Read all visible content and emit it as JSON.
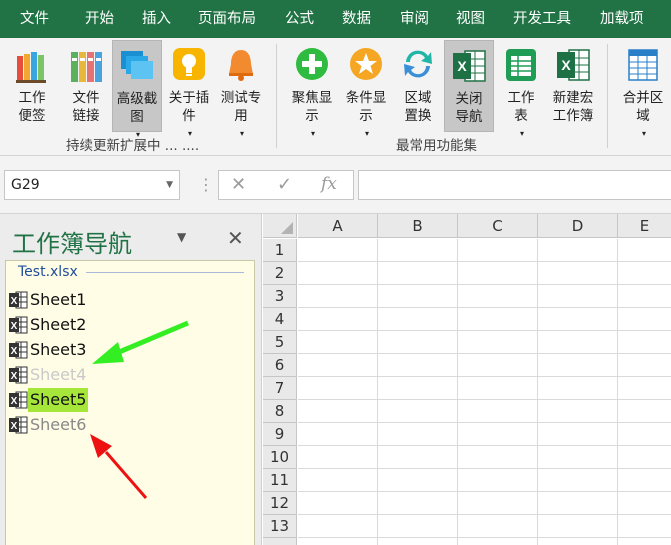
{
  "menu": {
    "items": [
      "文件",
      "开始",
      "插入",
      "页面布局",
      "公式",
      "数据",
      "审阅",
      "视图",
      "开发工具",
      "加载项"
    ]
  },
  "ribbon": {
    "buttons": [
      {
        "line1": "工作",
        "line2": "便签",
        "icon": "sticky-notes-icon"
      },
      {
        "line1": "文件",
        "line2": "链接",
        "icon": "file-link-icon"
      },
      {
        "line1": "高级截",
        "line2": "图",
        "icon": "screenshot-icon",
        "dropdown": true,
        "selected": true
      },
      {
        "line1": "关于插",
        "line2": "件",
        "icon": "lightbulb-icon",
        "dropdown": true
      },
      {
        "line1": "测试专",
        "line2": "用",
        "icon": "bell-icon",
        "dropdown": true
      },
      {
        "line1": "聚焦显",
        "line2": "示",
        "icon": "plus-circle-icon",
        "dropdown": true
      },
      {
        "line1": "条件显",
        "line2": "示",
        "icon": "star-circle-icon",
        "dropdown": true
      },
      {
        "line1": "区域",
        "line2": "置换",
        "icon": "swap-arrows-icon"
      },
      {
        "line1": "关闭",
        "line2": "导航",
        "icon": "excel-icon",
        "selected": true
      },
      {
        "line1": "工作",
        "line2": "表",
        "icon": "worksheet-icon",
        "dropdown": true
      },
      {
        "line1": "新建宏",
        "line2": "工作簿",
        "icon": "macro-workbook-icon"
      },
      {
        "line1": "合并区",
        "line2": "域",
        "icon": "merge-range-icon",
        "dropdown": true
      }
    ],
    "groups": {
      "group1": "持续更新扩展中 ... ....",
      "group2": "最常用功能集"
    },
    "dropdown_arrow": "▾"
  },
  "formula_bar": {
    "name_box": "G29",
    "cancel": "✕",
    "confirm": "✓",
    "fx": "fx",
    "formula": ""
  },
  "navigator": {
    "title": "工作簿导航",
    "dropdown_glyph": "▼",
    "close_glyph": "✕",
    "file_name": "Test.xlsx",
    "sheets": [
      {
        "name": "Sheet1",
        "state": "normal"
      },
      {
        "name": "Sheet2",
        "state": "normal"
      },
      {
        "name": "Sheet3",
        "state": "normal"
      },
      {
        "name": "Sheet4",
        "state": "hidden"
      },
      {
        "name": "Sheet5",
        "state": "active"
      },
      {
        "name": "Sheet6",
        "state": "veryhidden"
      }
    ]
  },
  "grid": {
    "columns": [
      "A",
      "B",
      "C",
      "D",
      "E"
    ],
    "rows": [
      "1",
      "2",
      "3",
      "4",
      "5",
      "6",
      "7",
      "8",
      "9",
      "10",
      "11",
      "12",
      "13"
    ]
  },
  "colors": {
    "accent": "#217346",
    "active_sheet": "#a6e63a",
    "green_arrow": "#33ee22",
    "red_arrow": "#ee1111"
  }
}
